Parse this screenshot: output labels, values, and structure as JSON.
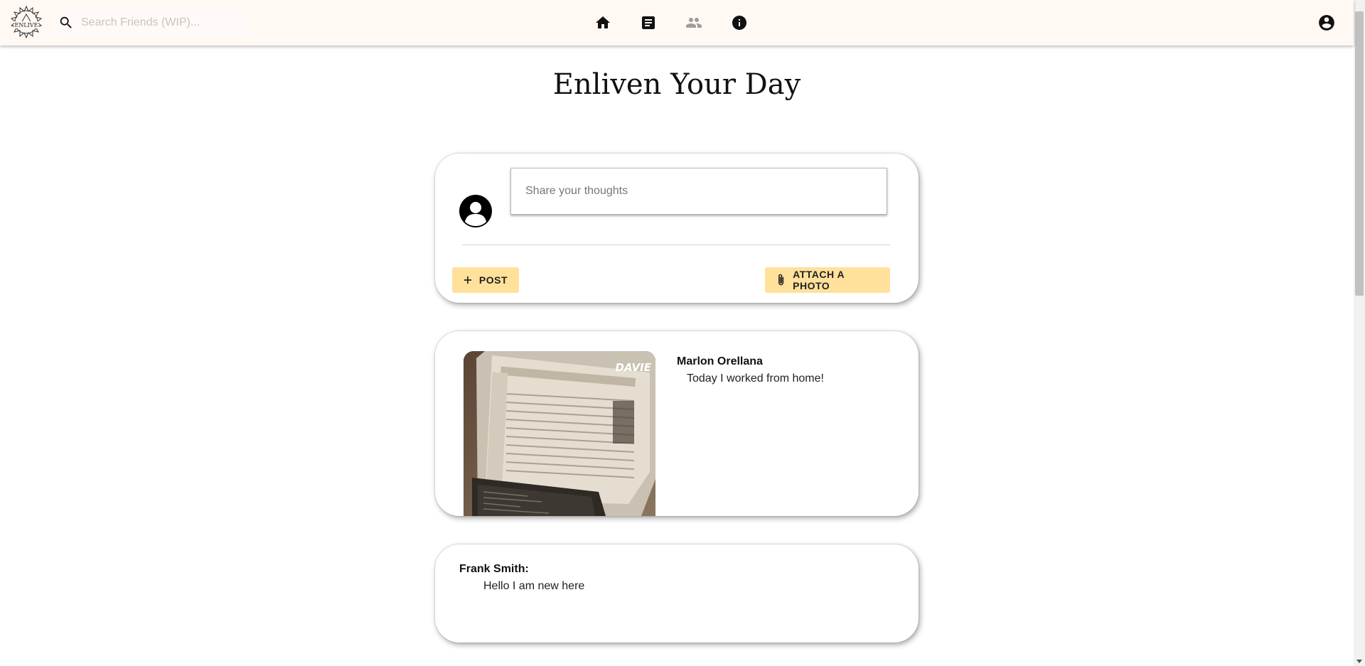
{
  "header": {
    "logo_text": "ENLIVE",
    "search": {
      "placeholder": "Search Friends (WIP)..."
    },
    "nav": [
      {
        "icon": "home-icon",
        "active": true
      },
      {
        "icon": "article-icon",
        "active": true
      },
      {
        "icon": "people-icon",
        "active": false
      },
      {
        "icon": "info-icon",
        "active": true
      }
    ],
    "account_icon": "account-circle-icon"
  },
  "page": {
    "title": "Enliven Your Day"
  },
  "composer": {
    "placeholder": "Share your thoughts",
    "post_label": "POST",
    "attach_label": "ATTACH A PHOTO"
  },
  "posts": [
    {
      "author": "Marlon Orellana",
      "text": "Today I worked from home!",
      "has_photo": true,
      "photo_caption": "DAVIE"
    },
    {
      "author": "Frank Smith:",
      "text": "Hello I am new here",
      "has_photo": false
    }
  ],
  "colors": {
    "header_bg": "#fff8f3",
    "button_bg": "#ffe19c",
    "inactive_icon": "#9e9e9e"
  }
}
